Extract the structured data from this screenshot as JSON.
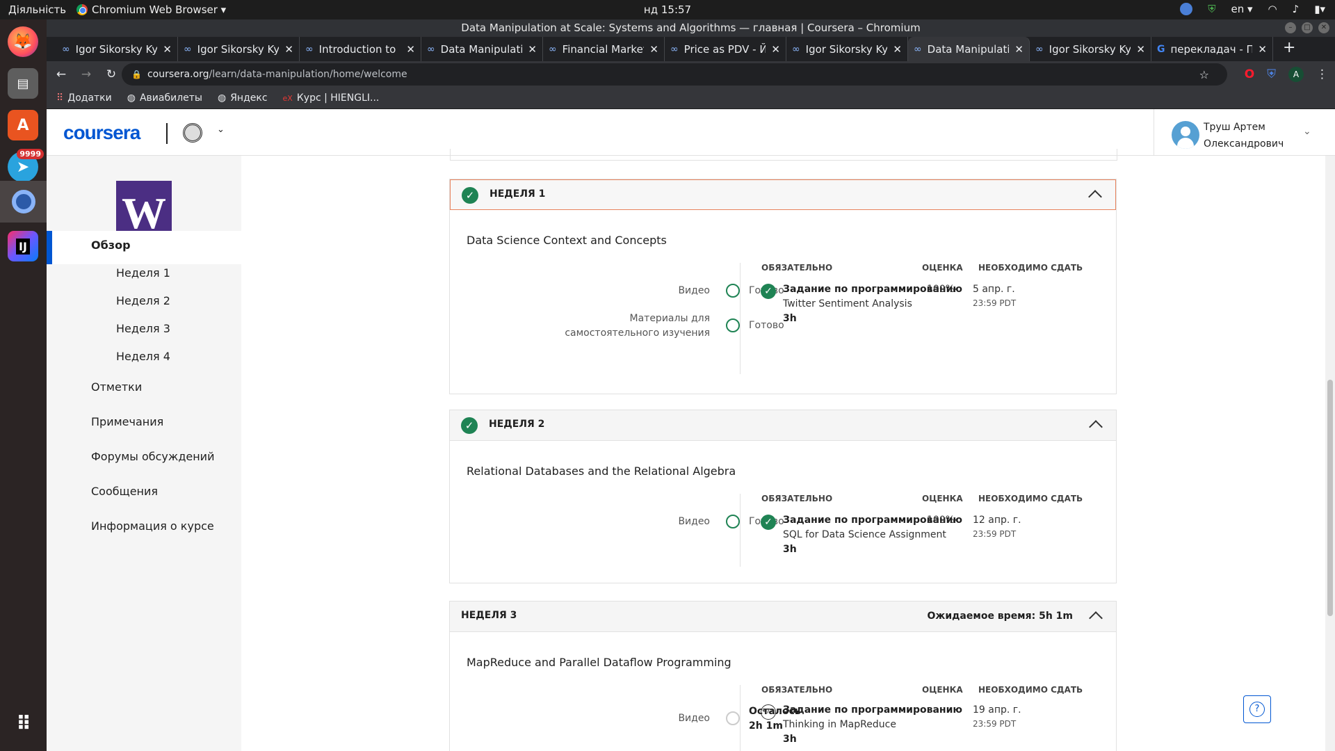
{
  "os": {
    "activities": "Діяльність",
    "app_name": "Chromium Web Browser ▾",
    "clock": "нд 15:57",
    "lang": "en ▾",
    "dock_badge": "9999"
  },
  "window": {
    "title": "Data Manipulation at Scale: Systems and Algorithms — главная | Coursera – Chromium"
  },
  "tabs": [
    {
      "label": "Igor Sikorsky Kyi"
    },
    {
      "label": "Igor Sikorsky Kyi"
    },
    {
      "label": "Introduction to"
    },
    {
      "label": "Data Manipulati"
    },
    {
      "label": "Financial Market"
    },
    {
      "label": "Price as PDV - Й"
    },
    {
      "label": "Igor Sikorsky Kyi"
    },
    {
      "label": "Data Manipulati"
    },
    {
      "label": "Igor Sikorsky Kyi"
    },
    {
      "label": "перекладач - По"
    }
  ],
  "address": {
    "host": "coursera.org",
    "path": "/learn/data-manipulation/home/welcome"
  },
  "bookmarks": [
    {
      "label": "Додатки"
    },
    {
      "label": "Авиабилеты"
    },
    {
      "label": "Яндекс"
    },
    {
      "label": "Курс | HIENGLI..."
    }
  ],
  "header": {
    "logo": "coursera",
    "user_first": "Труш Артем",
    "user_last": "Олександрович"
  },
  "sidebar": {
    "logo_letter": "W",
    "overview": "Обзор",
    "weeks": [
      "Неделя 1",
      "Неделя 2",
      "Неделя 3",
      "Неделя 4"
    ],
    "grades": "Отметки",
    "notes": "Примечания",
    "forums": "Форумы обсуждений",
    "messages": "Сообщения",
    "info": "Информация о курсе"
  },
  "columns": {
    "required": "ОБЯЗАТЕЛЬНО",
    "grade": "ОЦЕНКА",
    "due": "НЕОБХОДИМО СДАТЬ"
  },
  "weeks": [
    {
      "label": "НЕДЕЛЯ 1",
      "title": "Data Science Context and Concepts",
      "materials": [
        {
          "label": "Видео",
          "status": "Готово"
        },
        {
          "label_line1": "Материалы для",
          "label_line2": "самостоятельного изучения",
          "status": "Готово"
        }
      ],
      "assignment": {
        "type": "Задание по программированию",
        "name": "Twitter Sentiment Analysis",
        "duration": "3h",
        "grade": "100%",
        "due_date": "5 апр. г.",
        "due_time": "23:59 PDT"
      }
    },
    {
      "label": "НЕДЕЛЯ 2",
      "title": "Relational Databases and the Relational Algebra",
      "materials": [
        {
          "label": "Видео",
          "status": "Готово"
        }
      ],
      "assignment": {
        "type": "Задание по программированию",
        "name": "SQL for Data Science Assignment",
        "duration": "3h",
        "grade": "100%",
        "due_date": "12 апр. г.",
        "due_time": "23:59 PDT"
      }
    },
    {
      "label": "НЕДЕЛЯ 3",
      "expected_time": "Ожидаемое время: 5h 1m",
      "title": "MapReduce and Parallel Dataflow Programming",
      "materials": [
        {
          "label": "Видео",
          "status_line1": "Осталось",
          "status_line2": "2h 1m"
        }
      ],
      "assignment": {
        "type": "Задание по программированию",
        "name": "Thinking in MapReduce",
        "duration": "3h",
        "due_date": "19 апр. г.",
        "due_time": "23:59 PDT"
      }
    }
  ],
  "colors": {
    "brand": "#0056d2",
    "success": "#1f8354",
    "uw_purple": "#4b2e83",
    "highlight_border": "#e8835d"
  }
}
